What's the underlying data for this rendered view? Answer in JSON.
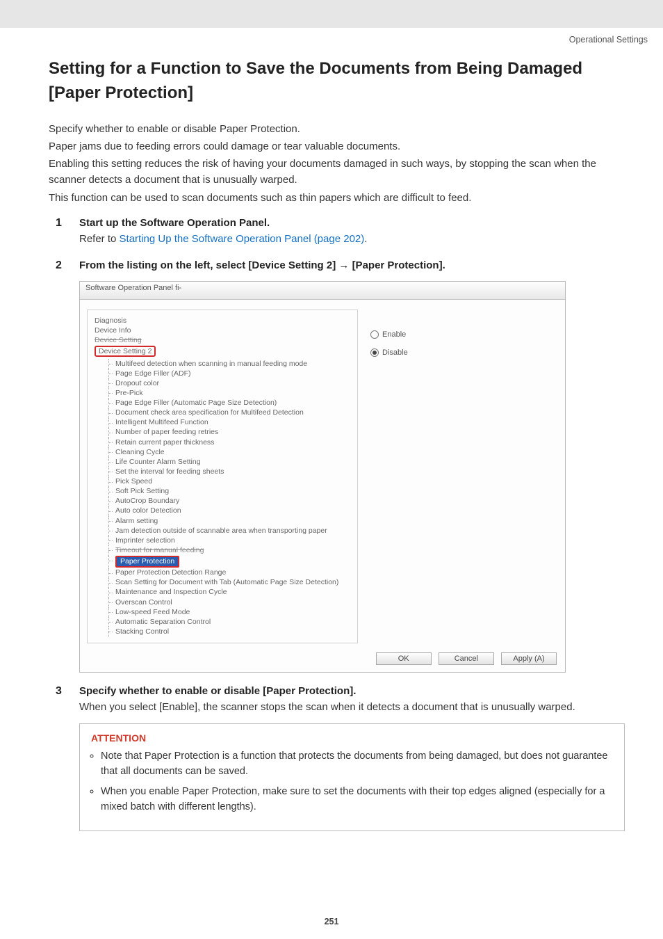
{
  "header": {
    "breadcrumb": "Operational Settings"
  },
  "title": "Setting for a Function to Save the Documents from Being Damaged [Paper Protection]",
  "intro": {
    "p1": "Specify whether to enable or disable Paper Protection.",
    "p2": "Paper jams due to feeding errors could damage or tear valuable documents.",
    "p3": "Enabling this setting reduces the risk of having your documents damaged in such ways, by stopping the scan when the scanner detects a document that is unusually warped.",
    "p4": "This function can be used to scan documents such as thin papers which are difficult to feed."
  },
  "steps": {
    "s1": {
      "title": "Start up the Software Operation Panel.",
      "body_prefix": "Refer to ",
      "link": "Starting Up the Software Operation Panel (page 202)",
      "body_suffix": "."
    },
    "s2": {
      "title": "From the listing on the left, select [Device Setting 2] → [Paper Protection]."
    },
    "s3": {
      "title": "Specify whether to enable or disable [Paper Protection].",
      "body": "When you select [Enable], the scanner stops the scan when it detects a document that is unusually warped."
    }
  },
  "shot": {
    "window_title": "Software Operation Panel fi-",
    "root": {
      "r1": "Diagnosis",
      "r2": "Device Info",
      "r3": "Device Setting",
      "r4": "Device Setting 2"
    },
    "tree": [
      "Multifeed detection when scanning in manual feeding mode",
      "Page Edge Filler (ADF)",
      "Dropout color",
      "Pre-Pick",
      "Page Edge Filler (Automatic Page Size Detection)",
      "Document check area specification for Multifeed Detection",
      "Intelligent Multifeed Function",
      "Number of paper feeding retries",
      "Retain current paper thickness",
      "Cleaning Cycle",
      "Life Counter Alarm Setting",
      "Set the interval for feeding sheets",
      "Pick Speed",
      "Soft Pick Setting",
      "AutoCrop Boundary",
      "Auto color Detection",
      "Alarm setting",
      "Jam detection outside of scannable area when transporting paper",
      "Imprinter selection",
      "Timeout for manual feeding"
    ],
    "selected": "Paper Protection",
    "tree_after": [
      "Paper Protection Detection Range",
      "Scan Setting for Document with Tab (Automatic Page Size Detection)",
      "Maintenance and Inspection Cycle",
      "Overscan Control",
      "Low-speed Feed Mode",
      "Automatic Separation Control",
      "Stacking Control"
    ],
    "radios": {
      "enable": "Enable",
      "disable": "Disable"
    },
    "buttons": {
      "ok": "OK",
      "cancel": "Cancel",
      "apply": "Apply (A)"
    }
  },
  "attention": {
    "label": "ATTENTION",
    "b1": "Note that Paper Protection is a function that protects the documents from being damaged, but does not guarantee that all documents can be saved.",
    "b2": "When you enable Paper Protection, make sure to set the documents with their top edges aligned (especially for a mixed batch with different lengths)."
  },
  "page_number": "251"
}
